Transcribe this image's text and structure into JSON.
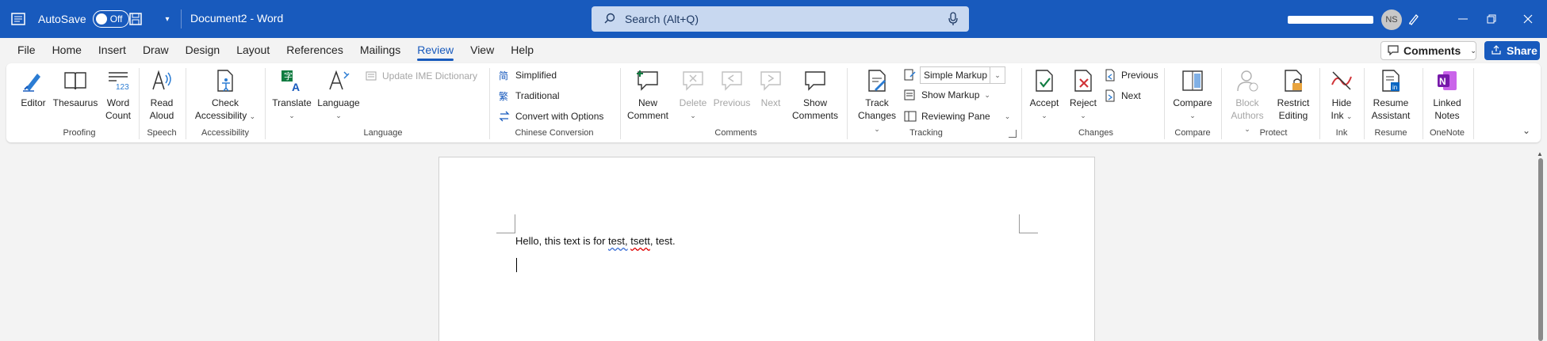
{
  "titlebar": {
    "autosave_label": "AutoSave",
    "autosave_state": "Off",
    "doc_title": "Document2 - Word",
    "search_placeholder": "Search (Alt+Q)",
    "user_initials": "NS",
    "accent": "#185abd"
  },
  "menu": [
    "File",
    "Home",
    "Insert",
    "Draw",
    "Design",
    "Layout",
    "References",
    "Mailings",
    "Review",
    "View",
    "Help"
  ],
  "menu_active": "Review",
  "actions": {
    "comments": "Comments",
    "share": "Share"
  },
  "ribbon": {
    "proofing": {
      "label": "Proofing",
      "editor": "Editor",
      "thesaurus": "Thesaurus",
      "word_count_1": "Word",
      "word_count_2": "Count"
    },
    "speech": {
      "label": "Speech",
      "read_aloud_1": "Read",
      "read_aloud_2": "Aloud"
    },
    "accessibility": {
      "label": "Accessibility",
      "check_1": "Check",
      "check_2": "Accessibility"
    },
    "language": {
      "label": "Language",
      "translate": "Translate",
      "language": "Language",
      "update_ime": "Update IME Dictionary"
    },
    "chinese": {
      "label": "Chinese Conversion",
      "simplified": "Simplified",
      "traditional": "Traditional",
      "convert": "Convert with Options"
    },
    "comments": {
      "label": "Comments",
      "new_1": "New",
      "new_2": "Comment",
      "delete": "Delete",
      "previous": "Previous",
      "next": "Next",
      "show_1": "Show",
      "show_2": "Comments"
    },
    "tracking": {
      "label": "Tracking",
      "track_1": "Track",
      "track_2": "Changes",
      "markup_select": "Simple Markup",
      "show_markup": "Show Markup",
      "reviewing_pane": "Reviewing Pane"
    },
    "changes": {
      "label": "Changes",
      "accept": "Accept",
      "reject": "Reject",
      "previous": "Previous",
      "next": "Next"
    },
    "compare": {
      "label": "Compare",
      "compare": "Compare"
    },
    "protect": {
      "label": "Protect",
      "block_1": "Block",
      "block_2": "Authors",
      "restrict_1": "Restrict",
      "restrict_2": "Editing"
    },
    "ink": {
      "label": "Ink",
      "hide_1": "Hide",
      "hide_2": "Ink"
    },
    "resume": {
      "label": "Resume",
      "assistant_1": "Resume",
      "assistant_2": "Assistant"
    },
    "onenote": {
      "label": "OneNote",
      "linked_1": "Linked",
      "linked_2": "Notes"
    }
  },
  "document": {
    "text_before": "Hello, this text is for ",
    "word_test1": "test,",
    "word_tsett": "tsett",
    "text_after": ", test."
  }
}
